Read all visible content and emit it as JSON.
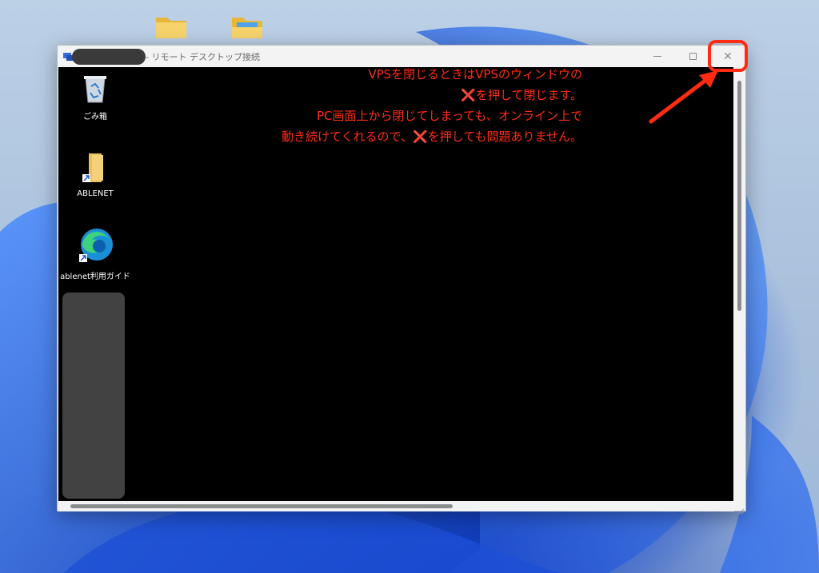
{
  "window": {
    "title_suffix": "- リモート デスクトップ接続",
    "minimize_label": "",
    "maximize_label": "",
    "close_label": "✕"
  },
  "remote_desktop": {
    "icons": [
      {
        "label": "ごみ箱",
        "icon": "recycle-bin-icon"
      },
      {
        "label": "ABLENET",
        "icon": "folder-shortcut-icon"
      },
      {
        "label": "ablenet利用ガイド",
        "icon": "edge-shortcut-icon"
      }
    ]
  },
  "desktop": {
    "icons": [
      {
        "icon": "folder-icon"
      },
      {
        "icon": "folder-with-picture-icon"
      }
    ]
  },
  "annotation": {
    "line1": "VPSを閉じるときはVPSのウィンドウの",
    "line2_mark": "❌",
    "line2_text": "を押して閉じます。",
    "line3": "PC画面上から閉じてしまっても、オンライン上で",
    "line4_a": "動き続けてくれるので、",
    "line4_mark": "❌",
    "line4_b": "を押しても問題ありません。",
    "color": "#ff2b12"
  }
}
